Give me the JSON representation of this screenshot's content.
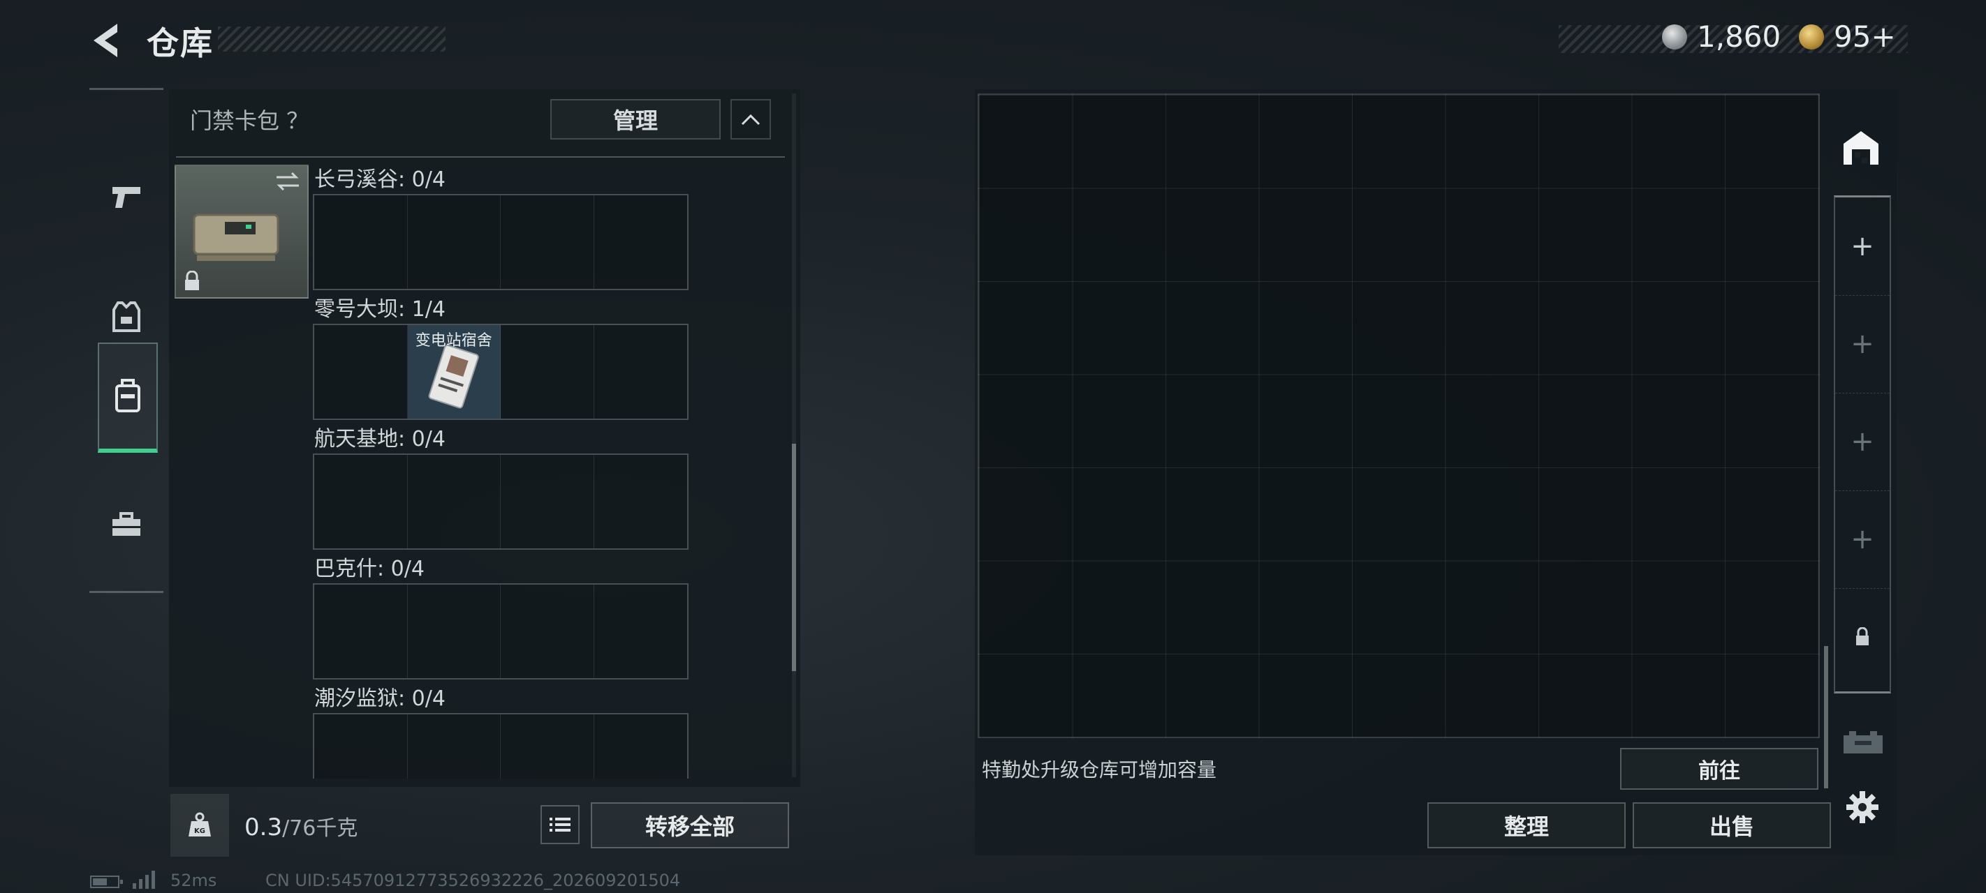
{
  "header": {
    "title": "仓库"
  },
  "currency": [
    {
      "name": "silver-coin",
      "value": "1,860"
    },
    {
      "name": "gold-coin",
      "value": "95+"
    }
  ],
  "categories": [
    {
      "icon": "pistol-icon",
      "active": false
    },
    {
      "icon": "armor-vest-icon",
      "active": false
    },
    {
      "icon": "backpack-icon",
      "active": true
    },
    {
      "icon": "toolbox-icon",
      "active": false
    }
  ],
  "card_pack": {
    "title": "门禁卡包 ？",
    "manage_label": "管理",
    "sections": [
      {
        "label": "长弓溪谷: 0/4",
        "slots": [
          "",
          "",
          "",
          ""
        ]
      },
      {
        "label": "零号大坝: 1/4",
        "slots": [
          "",
          "变电站宿舍",
          "",
          ""
        ]
      },
      {
        "label": "航天基地: 0/4",
        "slots": [
          "",
          "",
          "",
          ""
        ]
      },
      {
        "label": "巴克什: 0/4",
        "slots": [
          "",
          "",
          "",
          ""
        ]
      },
      {
        "label": "潮汐监狱: 0/4",
        "slots": [
          "",
          "",
          "",
          ""
        ]
      }
    ]
  },
  "bottom_left": {
    "weight_value": "0.3",
    "weight_total": "/76千克",
    "transfer_all_label": "转移全部"
  },
  "storage": {
    "hint": "特勤处升级仓库可增加容量",
    "goto_label": "前往",
    "sort_label": "整理",
    "sell_label": "出售"
  },
  "pages": [
    "warehouse-icon",
    "+",
    "+",
    "+",
    "+",
    "lock-icon"
  ],
  "status_bar": {
    "ping": "52ms",
    "uid": "CN UID:54570912773526932226_202609201504"
  }
}
